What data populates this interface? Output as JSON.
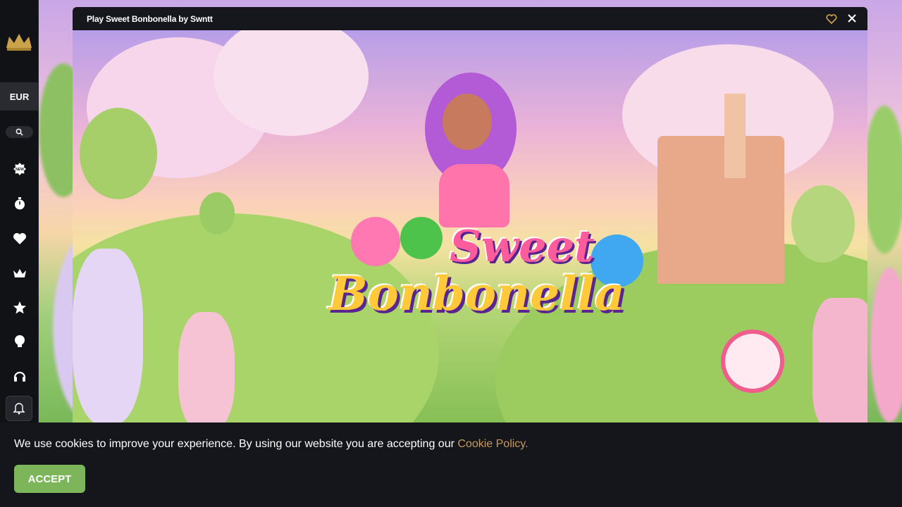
{
  "sidebar": {
    "currency": "EUR",
    "icons": [
      "new-icon",
      "stopwatch-icon",
      "heart-icon",
      "crown-icon",
      "star-icon",
      "trophy-icon",
      "headset-icon",
      "bell-icon"
    ]
  },
  "modal": {
    "title": "Play Sweet Bonbonella by Swntt"
  },
  "game": {
    "logo_line_1": "Sweet",
    "logo_line_2": "Bonbonella"
  },
  "cookie": {
    "text": "We use cookies to improve your experience. By using our website you are accepting our ",
    "link": "Cookie Policy.",
    "accept": "ACCEPT"
  },
  "colors": {
    "accent": "#7db55a",
    "link": "#c99a5b",
    "gold": "#d4a54a"
  }
}
